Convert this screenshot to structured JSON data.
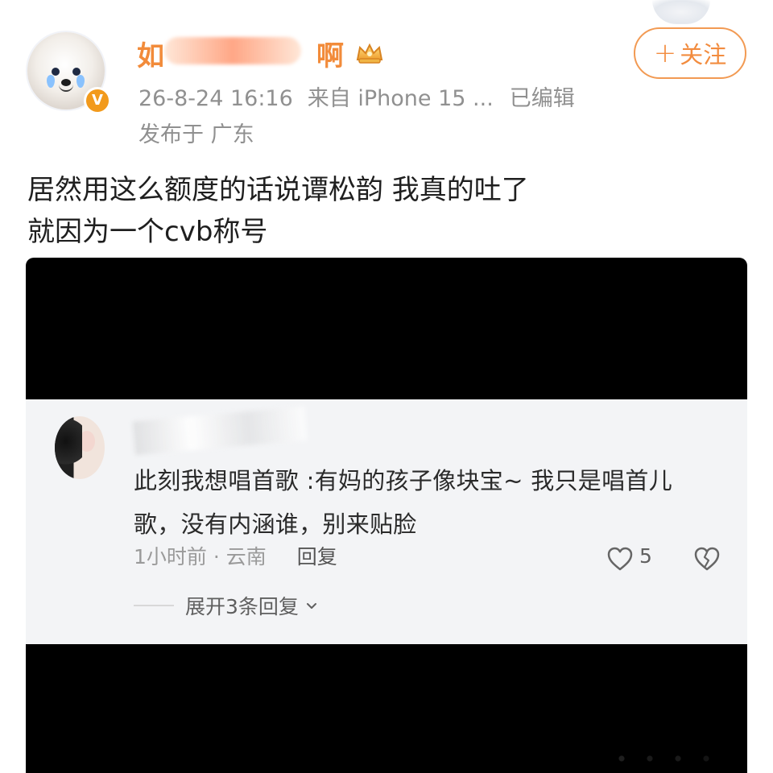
{
  "post": {
    "author_visible": "如",
    "author_visible_end": "啊",
    "timestamp": "26-8-24 16:16",
    "source": "来自 iPhone 15 ...",
    "edited_label": "已编辑",
    "location": "发布于 广东",
    "follow_label": "关注",
    "follow_plus": "+",
    "text_line_1": "居然用这么额度的话说谭松韵 我真的吐了",
    "text_line_2": "就因为一个cvb称号"
  },
  "embedded_comment": {
    "text": "此刻我想唱首歌 :有妈的孩子像块宝~ 我只是唱首儿歌，没有内涵谁，别来贴脸",
    "time_location": "1小时前 · 云南",
    "reply_label": "回复",
    "likes": "5",
    "expand_replies_label": "展开3条回复"
  },
  "icons": {
    "verified": "verified-icon",
    "crown": "crown-icon",
    "like": "heart-outline-icon",
    "dislike": "broken-heart-icon",
    "expand": "chevron-down-icon"
  },
  "colors": {
    "accent_orange": "#f28c3f",
    "text_primary": "#1f1f1f",
    "text_muted": "#909090",
    "embedded_bg": "#f3f4f6",
    "media_bg": "#000000"
  }
}
